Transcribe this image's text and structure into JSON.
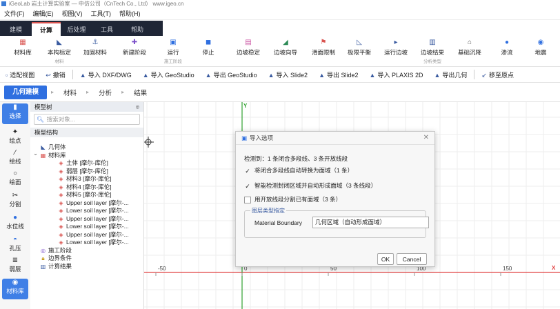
{
  "window": {
    "title": "iGeoLab 岩土计算实验室 — 中仿公司（CnTech Co., Ltd）  www.igeo.cn"
  },
  "menu": [
    "文件(F)",
    "编辑(E)",
    "视图(V)",
    "工具(T)",
    "帮助(H)"
  ],
  "tabs": [
    {
      "label": "建模",
      "active": false
    },
    {
      "label": "计算",
      "active": true
    },
    {
      "label": "后处理",
      "active": false
    },
    {
      "label": "工具",
      "active": false
    },
    {
      "label": "帮助",
      "active": false
    }
  ],
  "ribbon": [
    {
      "label": "材料库",
      "sub": "",
      "icon": "grid-icon",
      "color": "#d9534f"
    },
    {
      "label": "本构标定",
      "sub": "材料",
      "icon": "chart-icon",
      "color": "#3a5ba0"
    },
    {
      "label": "加固材料",
      "sub": "",
      "icon": "reinforce-icon",
      "color": "#3a5ba0"
    },
    {
      "label": "新建阶段",
      "sub": "",
      "icon": "plus-icon",
      "color": "#7b4fc9"
    },
    {
      "label": "运行",
      "sub": "施工阶段",
      "icon": "run-icon",
      "color": "#2f6fe0"
    },
    {
      "label": "停止",
      "sub": "",
      "icon": "stop-icon",
      "color": "#2f6fe0"
    },
    {
      "label": "边坡稳定",
      "sub": "",
      "icon": "slope-icon",
      "color": "#c94fa0"
    },
    {
      "label": "边坡向导",
      "sub": "",
      "icon": "slope-wizard-icon",
      "color": "#2e8b57"
    },
    {
      "label": "滑面限制",
      "sub": "",
      "icon": "flag-icon",
      "color": "#d9534f"
    },
    {
      "label": "极限平衡",
      "sub": "",
      "icon": "balance-icon",
      "color": "#3a5ba0"
    },
    {
      "label": "运行边坡",
      "sub": "",
      "icon": "run-slope-icon",
      "color": "#3a5ba0"
    },
    {
      "label": "边坡结果",
      "sub": "分析类型",
      "icon": "result-icon",
      "color": "#3a5ba0"
    },
    {
      "label": "基础沉降",
      "sub": "",
      "icon": "foundation-icon",
      "color": "#555555"
    },
    {
      "label": "渗流",
      "sub": "",
      "icon": "water-drop-icon",
      "color": "#2f6fe0"
    },
    {
      "label": "地震",
      "sub": "",
      "icon": "earthquake-icon",
      "color": "#2f6fe0"
    }
  ],
  "toolbar": [
    {
      "label": "适配视图",
      "icon": "fit-icon"
    },
    {
      "label": "撤销",
      "icon": "undo-icon"
    },
    {
      "label": "导入 DXF/DWG",
      "icon": "import-icon"
    },
    {
      "label": "导入 GeoStudio",
      "icon": "import-icon"
    },
    {
      "label": "导出 GeoStudio",
      "icon": "export-icon"
    },
    {
      "label": "导入 Slide2",
      "icon": "import-icon"
    },
    {
      "label": "导出 Slide2",
      "icon": "export-icon"
    },
    {
      "label": "导入 PLAXIS 2D",
      "icon": "import-icon"
    },
    {
      "label": "导出几何",
      "icon": "export-icon"
    },
    {
      "label": "移至原点",
      "icon": "move-origin-icon"
    }
  ],
  "steps": [
    {
      "label": "几何建模",
      "active": true
    },
    {
      "label": "材料",
      "active": false
    },
    {
      "label": "分析",
      "active": false
    },
    {
      "label": "结果",
      "active": false
    }
  ],
  "leftbar": [
    {
      "label": "选择",
      "icon": "cursor-icon",
      "active": true
    },
    {
      "label": "绘点",
      "icon": "point-icon",
      "active": false
    },
    {
      "label": "绘线",
      "icon": "line-icon",
      "active": false
    },
    {
      "label": "绘面",
      "icon": "polygon-icon",
      "active": false
    },
    {
      "label": "分割",
      "icon": "scissors-icon",
      "active": false
    },
    {
      "label": "水位线",
      "icon": "water-drop-icon",
      "active": false
    },
    {
      "label": "孔压",
      "icon": "pressure-icon",
      "active": false
    },
    {
      "label": "弱层",
      "icon": "weak-layer-icon",
      "active": false
    },
    {
      "label": "材料库",
      "icon": "material-icon",
      "active": true
    }
  ],
  "tree": {
    "header": "模型树",
    "search_placeholder": "搜索对象...",
    "section": "模型结构",
    "nodes": [
      {
        "label": "几何体",
        "icon": "geometry-icon",
        "level": 1,
        "expand": ""
      },
      {
        "label": "材料库",
        "icon": "material-lib-icon",
        "level": 1,
        "expand": "⌄"
      },
      {
        "label": "土体 [摩尔-库伦]",
        "icon": "material-item-icon",
        "level": 2,
        "expand": ""
      },
      {
        "label": "弱层 [摩尔-库伦]",
        "icon": "material-item-icon",
        "level": 2,
        "expand": ""
      },
      {
        "label": "材料3 [摩尔-库伦]",
        "icon": "material-item-icon",
        "level": 2,
        "expand": ""
      },
      {
        "label": "材料4 [摩尔-库伦]",
        "icon": "material-item-icon",
        "level": 2,
        "expand": ""
      },
      {
        "label": "材料5 [摩尔-库伦]",
        "icon": "material-item-icon",
        "level": 2,
        "expand": ""
      },
      {
        "label": "Upper soil layer [摩尔-...",
        "icon": "material-item-icon",
        "level": 2,
        "expand": ""
      },
      {
        "label": "Lower soil layer [摩尔-...",
        "icon": "material-item-icon",
        "level": 2,
        "expand": ""
      },
      {
        "label": "Upper soil layer [摩尔-...",
        "icon": "material-item-icon",
        "level": 2,
        "expand": ""
      },
      {
        "label": "Lower soil layer [摩尔-...",
        "icon": "material-item-icon",
        "level": 2,
        "expand": ""
      },
      {
        "label": "Upper soil layer [摩尔-...",
        "icon": "material-item-icon",
        "level": 2,
        "expand": ""
      },
      {
        "label": "Lower soil layer [摩尔-...",
        "icon": "material-item-icon",
        "level": 2,
        "expand": ""
      },
      {
        "label": "施工阶段",
        "icon": "stage-icon",
        "level": 1,
        "expand": ""
      },
      {
        "label": "边界条件",
        "icon": "lock-icon",
        "level": 1,
        "expand": ""
      },
      {
        "label": "计算结果",
        "icon": "result-chart-icon",
        "level": 1,
        "expand": ""
      }
    ]
  },
  "canvas": {
    "y_axis_label": "Y",
    "x_axis_label": "X",
    "ticks": [
      "-50",
      "0",
      "50",
      "100",
      "150"
    ],
    "axis_color": "#e04040",
    "y_axis_color": "#2ea02e"
  },
  "dialog": {
    "title": "导入选项",
    "detected": "检测到：1 条闭合多段线、3 条开放线段",
    "options": [
      {
        "label": "将闭合多段线自动转换为面域（1 条）",
        "checked": true
      },
      {
        "label": "智能检测封闭区域并自动形成面域（3 条线段）",
        "checked": true
      },
      {
        "label": "用开放线段分割已有面域（3 条）",
        "checked": false
      }
    ],
    "group_title": "图层类型指定",
    "field_label": "Material Boundary",
    "field_value": "几何区域（自动形成面域）",
    "ok_label": "OK",
    "cancel_label": "Cancel"
  }
}
